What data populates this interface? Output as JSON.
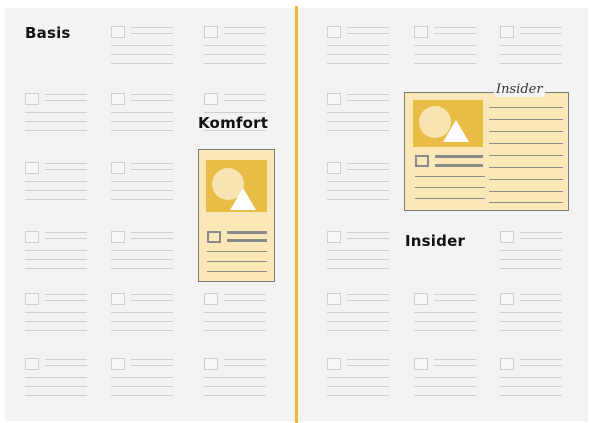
{
  "labels": {
    "basis": "Basis",
    "komfort": "Komfort",
    "insider": "Insider"
  },
  "insider_badge": "Insider",
  "colors": {
    "page_background": "#f3f3f3",
    "fold_line": "#f3b63c",
    "ad_fill": "#fbe8b8",
    "ad_image": "#e9bc45",
    "placeholder_lines": "#cfcfcf"
  }
}
